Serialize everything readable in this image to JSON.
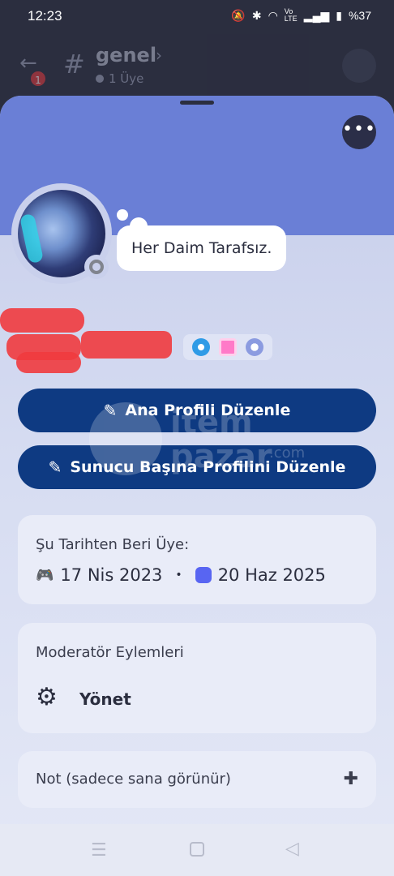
{
  "status_bar": {
    "time": "12:23",
    "icons": [
      "mute-icon",
      "bluetooth-icon",
      "wifi-icon",
      "volte-icon",
      "signal-icon",
      "battery-icon"
    ],
    "volte_label": "Vo LTE",
    "battery": "%37"
  },
  "channel": {
    "name": "genel",
    "subtitle": "1 Üye",
    "notification_count": "1"
  },
  "profile": {
    "status_message": "Her Daim Tarafsız.",
    "badges": [
      "hypesquad-badge",
      "nitro-badge",
      "server-boost-badge"
    ]
  },
  "buttons": {
    "edit_main_profile": "Ana Profili Düzenle",
    "edit_server_profile": "Sunucu Başına Profilini Düzenle"
  },
  "watermark": {
    "line1": "item",
    "line2": "pazar",
    "suffix": ".com"
  },
  "member_since": {
    "title": "Şu Tarihten Beri Üye:",
    "discord_date": "17 Nis 2023",
    "separator": "•",
    "server_date": "20 Haz 2025"
  },
  "moderator": {
    "title": "Moderatör Eylemleri",
    "manage_label": "Yönet"
  },
  "note": {
    "title": "Not (sadece sana görünür)"
  },
  "colors": {
    "banner": "#6a7fd6",
    "button": "#0e3a82",
    "status_offline": "#80848e",
    "redaction": "#ef3b3e"
  }
}
